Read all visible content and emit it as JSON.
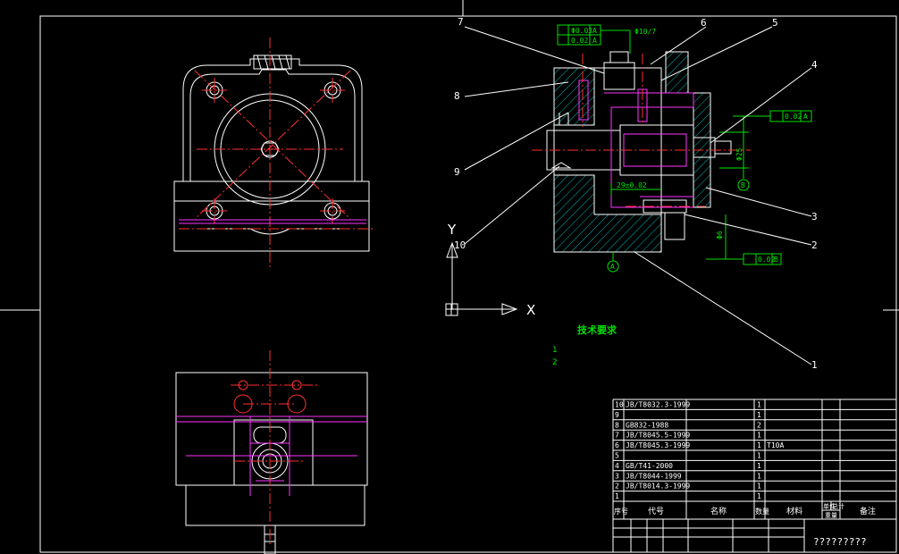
{
  "colors": {
    "background": "#000000",
    "outline": "#ffffff",
    "center_line": "#ff3030",
    "hidden_line": "#ff33ff",
    "dimension": "#00e000",
    "hatch": "#00b8b8"
  },
  "balloons": [
    "7",
    "6",
    "5",
    "4",
    "8",
    "9",
    "10",
    "3",
    "2",
    "1"
  ],
  "dimensions": {
    "tol_frame_1a": "Φ0.03",
    "tol_frame_1b": "A",
    "tol_frame_2a": "0.02",
    "tol_frame_2b": "A",
    "hole_label": "Φ10/7",
    "parallel_top": "0.02",
    "parallel_top_datum": "A",
    "datum_b": "B",
    "vertical_dim": "Φ25",
    "horizontal_dim": "29±0.02",
    "datum_a": "A",
    "lower_dim": "Φ6",
    "parallel_bottom": "0.02",
    "parallel_bottom_datum": "B"
  },
  "ucs": {
    "y": "Y",
    "x": "X"
  },
  "notes": {
    "title": "技术要求",
    "line1": "1  ",
    "line2": "2  "
  },
  "bom": {
    "rows": [
      {
        "no": "10",
        "code": "JB/T8032.3-1999",
        "name": "",
        "qty": "1",
        "mat": ""
      },
      {
        "no": "9",
        "code": "",
        "name": "",
        "qty": "1",
        "mat": ""
      },
      {
        "no": "8",
        "code": "GB832-1988",
        "name": "",
        "qty": "2",
        "mat": ""
      },
      {
        "no": "7",
        "code": "JB/T8045.5-1999",
        "name": "",
        "qty": "1",
        "mat": ""
      },
      {
        "no": "6",
        "code": "JB/T8045.3-1999",
        "name": "",
        "qty": "1",
        "mat": "T10A"
      },
      {
        "no": "5",
        "code": "",
        "name": "",
        "qty": "1",
        "mat": ""
      },
      {
        "no": "4",
        "code": "GB/T41-2000",
        "name": "",
        "qty": "1",
        "mat": ""
      },
      {
        "no": "3",
        "code": "JB/T8044-1999",
        "name": "",
        "qty": "1",
        "mat": ""
      },
      {
        "no": "2",
        "code": "JB/T8014.3-1999",
        "name": "",
        "qty": "1",
        "mat": ""
      },
      {
        "no": "1",
        "code": "",
        "name": "",
        "qty": "1",
        "mat": ""
      }
    ],
    "header": {
      "no": "序号",
      "code": "代号",
      "name": "名称",
      "qty": "数量",
      "mat": "材料",
      "unit_weight": "单件",
      "total_weight": "总计",
      "weight": "重量",
      "remark": "备注"
    },
    "stamp": "?????????"
  }
}
